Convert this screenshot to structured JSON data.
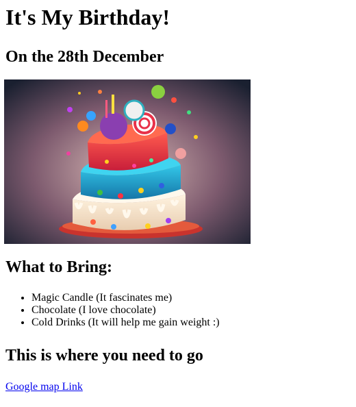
{
  "page": {
    "title": "It's My Birthday!",
    "date_heading": "On the 28th December",
    "bring_heading": "What to Bring:",
    "bring_items": [
      "Magic Candle (It fascinates me)",
      "Chocolate (I love chocolate)",
      "Cold Drinks (It will help me gain weight :)"
    ],
    "where_heading": "This is where you need to go",
    "map_link_text": "Google map Link"
  },
  "colors": {
    "link": "#0000ee",
    "text": "#000000",
    "background": "#ffffff"
  },
  "icons": {
    "cake_image": "birthday-cake-illustration"
  }
}
